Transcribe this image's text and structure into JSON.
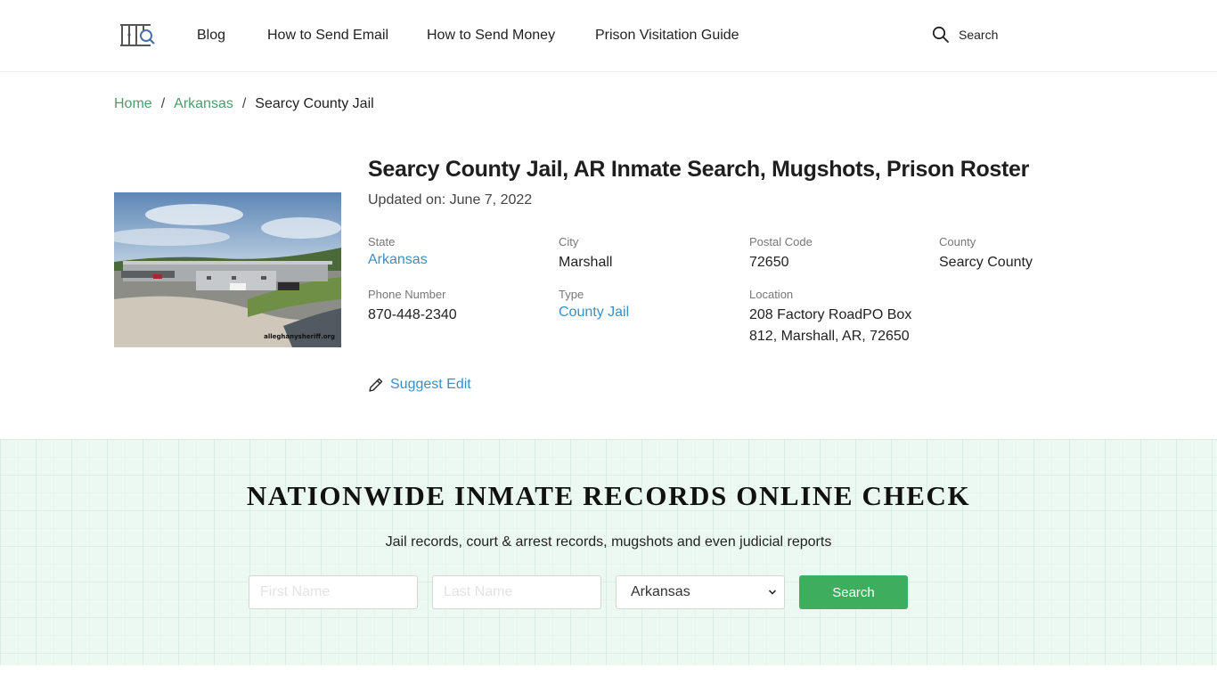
{
  "header": {
    "logo_icon": "jail-bars-magnifier-logo",
    "nav": [
      {
        "label": "Blog"
      },
      {
        "label": "How to Send Email"
      },
      {
        "label": "How to Send Money"
      },
      {
        "label": "Prison Visitation Guide"
      }
    ],
    "search": {
      "icon": "search-icon",
      "label": "Search"
    }
  },
  "breadcrumb": {
    "items": [
      {
        "label": "Home"
      },
      {
        "label": "Arkansas"
      },
      {
        "label": "Searcy County Jail"
      }
    ],
    "separator": "/"
  },
  "facility": {
    "photo_alt": "Searcy County Jail building",
    "photo_watermark": "alleghanysheriff.org",
    "title": "Searcy County Jail, AR Inmate Search, Mugshots, Prison Roster",
    "updated_label": "Updated on:",
    "updated_date": "June 7, 2022",
    "fields": {
      "state": {
        "label": "State",
        "value": "Arkansas"
      },
      "city": {
        "label": "City",
        "value": "Marshall"
      },
      "postal_code": {
        "label": "Postal Code",
        "value": "72650"
      },
      "county": {
        "label": "County",
        "value": "Searcy County"
      },
      "phone": {
        "label": "Phone Number",
        "value": "870-448-2340"
      },
      "type": {
        "label": "Type",
        "value": "County Jail"
      },
      "location": {
        "label": "Location",
        "value": "208 Factory RoadPO Box 812, Marshall, AR, 72650"
      }
    },
    "suggest_edit": {
      "icon": "pencil-icon",
      "label": "Suggest Edit"
    }
  },
  "inmate_search": {
    "title": "NATIONWIDE INMATE RECORDS ONLINE CHECK",
    "subtitle": "Jail records, court & arrest records, mugshots and even judicial reports",
    "first_name": {
      "placeholder": "First Name",
      "value": ""
    },
    "last_name": {
      "placeholder": "Last Name",
      "value": ""
    },
    "state_select": {
      "selected": "Arkansas"
    },
    "button_label": "Search"
  },
  "colors": {
    "link_green": "#4a9d6a",
    "link_blue": "#3a8fc4",
    "button_green": "#3cae5e",
    "band_bg": "#ecf8f2"
  }
}
